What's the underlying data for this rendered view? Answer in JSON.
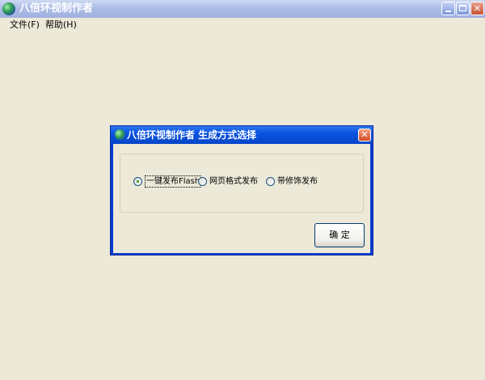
{
  "window": {
    "title": "八倍环视制作者",
    "icon": "app-globe-icon"
  },
  "menu": {
    "file": "文件(F)",
    "help": "帮助(H)"
  },
  "dialog": {
    "title": "八倍环视制作者 生成方式选择",
    "options": [
      {
        "label": "一键发布Flash",
        "selected": true
      },
      {
        "label": "网页格式发布",
        "selected": false
      },
      {
        "label": "带修饰发布",
        "selected": false
      }
    ],
    "ok_label": "确 定"
  }
}
